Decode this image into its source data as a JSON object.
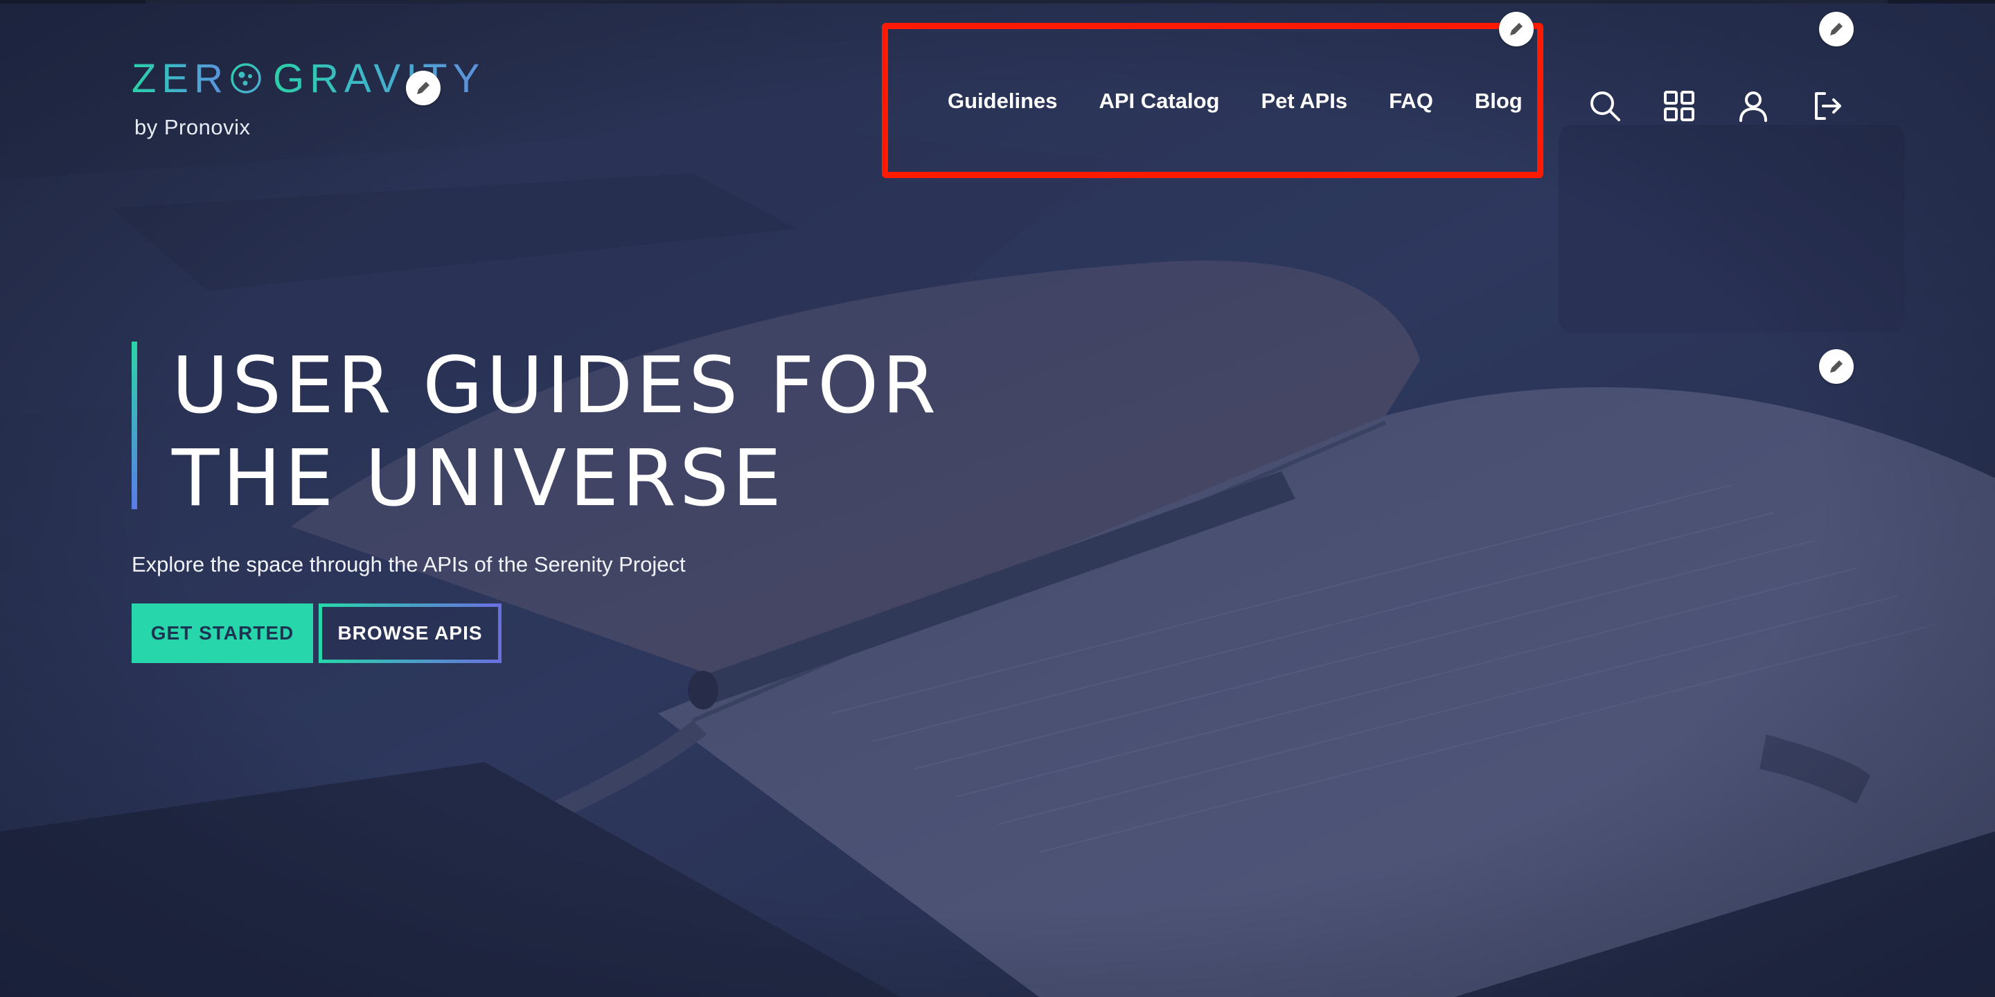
{
  "brand": {
    "wordmark_left": "ZER",
    "wordmark_right": "GRAVITY",
    "byline": "by Pronovix"
  },
  "nav": {
    "links": [
      {
        "label": "Guidelines"
      },
      {
        "label": "API Catalog"
      },
      {
        "label": "Pet APIs"
      },
      {
        "label": "FAQ"
      },
      {
        "label": "Blog"
      }
    ],
    "icons": [
      "search-icon",
      "apps-grid-icon",
      "user-icon",
      "logout-icon"
    ]
  },
  "hero": {
    "title_line_1": "USER GUIDES FOR",
    "title_line_2": "THE UNIVERSE",
    "subtitle": "Explore the space through the APIs of the Serenity Project",
    "primary_cta": "GET STARTED",
    "secondary_cta": "BROWSE APIS"
  },
  "colors": {
    "accent_green": "#27d6aa",
    "accent_blue": "#5a7ce6",
    "overlay": "#2b3556",
    "highlight": "#ff1a00"
  }
}
